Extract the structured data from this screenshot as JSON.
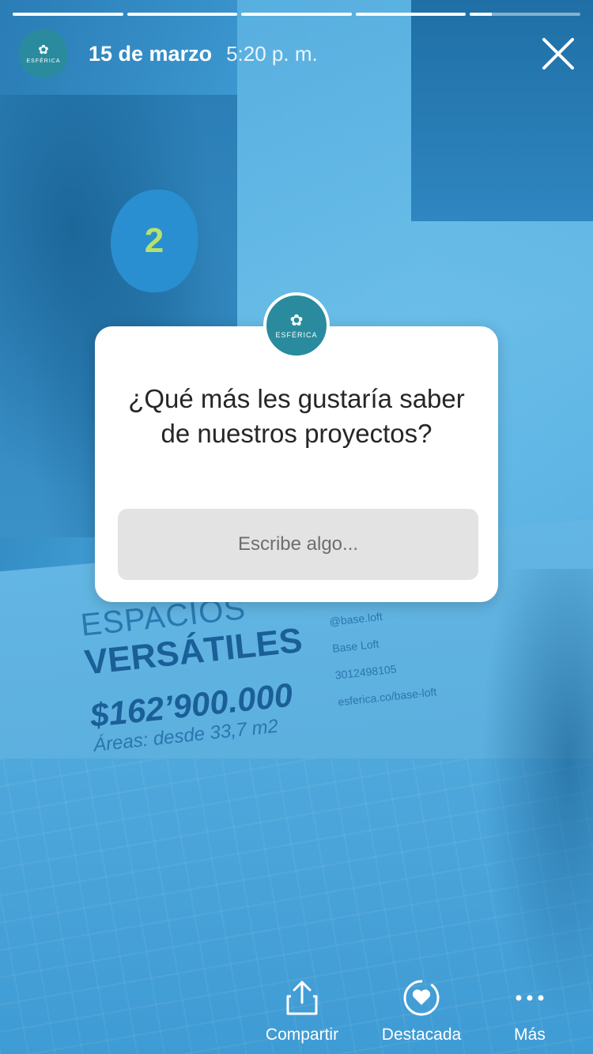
{
  "story": {
    "progress": [
      1,
      1,
      1,
      1,
      0.2
    ],
    "account": {
      "avatar_text": "ESFÉRICA"
    },
    "date": "15 de marzo",
    "time": "5:20 p. m.",
    "close_icon": "close-icon"
  },
  "background": {
    "sign_number": "2",
    "counter_title_1": "ESPACIOS",
    "counter_title_2": "VERSÁTILES",
    "counter_price": "$162’900.000",
    "counter_area": "Áreas: desde 33,7 m2",
    "counter_info": [
      "@base.loft",
      "Base Loft",
      "3012498105",
      "esferica.co/base-loft"
    ]
  },
  "question_sticker": {
    "avatar_text": "ESFÉRICA",
    "question": "¿Qué más les gustaría saber de nuestros proyectos?",
    "input_placeholder": "Escribe algo..."
  },
  "actions": {
    "share": {
      "label": "Compartir",
      "icon": "share-icon"
    },
    "highlight": {
      "label": "Destacada",
      "icon": "heart-highlight-icon"
    },
    "more": {
      "label": "Más",
      "icon": "more-dots-icon"
    }
  },
  "colors": {
    "overlay": "#3f9fd6",
    "avatar": "#2a8b9e",
    "card": "#ffffff",
    "input": "#e3e3e3"
  }
}
